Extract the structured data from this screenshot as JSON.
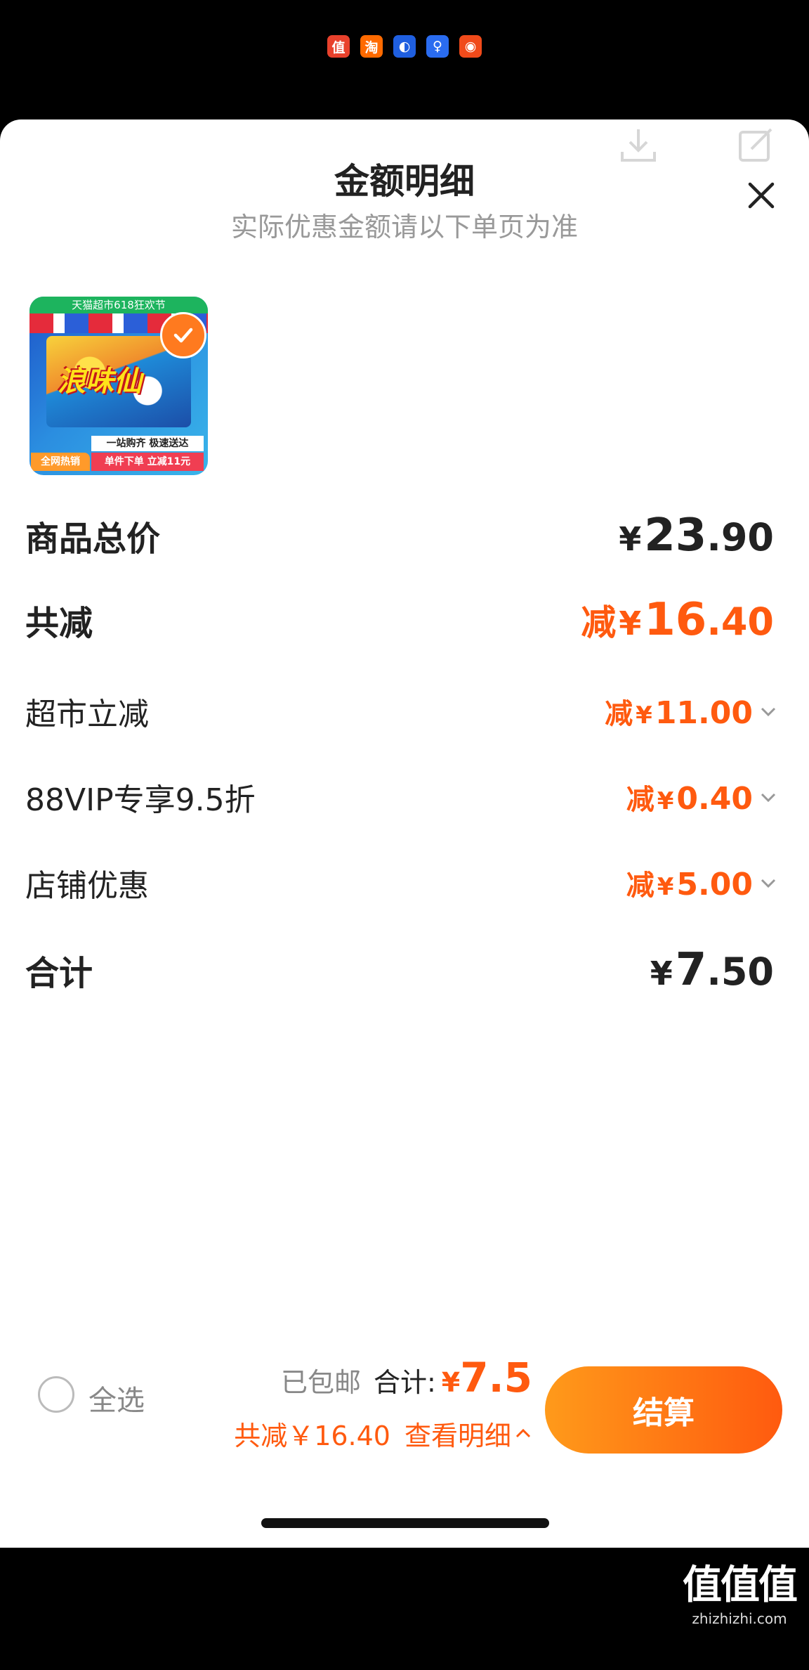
{
  "status_bar": {
    "app_icons": [
      {
        "name": "smzdm-app-icon",
        "glyph": "值",
        "color": "#e8412c"
      },
      {
        "name": "taobao-app-icon",
        "glyph": "淘",
        "color": "#ff6a00"
      },
      {
        "name": "blue-app-icon",
        "glyph": "◐",
        "color": "#1f5fe0"
      },
      {
        "name": "bulb-app-icon",
        "glyph": "♀",
        "color": "#2a6cf0"
      },
      {
        "name": "red-app-icon",
        "glyph": "◉",
        "color": "#f04a1a"
      }
    ]
  },
  "sheet": {
    "title": "金额明细",
    "subtitle": "实际优惠金额请以下单页为准"
  },
  "product": {
    "top_strip": "天猫超市618狂欢节",
    "brand": "浪味仙",
    "banner1": "一站购齐 极速送达",
    "banner2": "单件下单 立减11元",
    "hot_tag": "全网热销"
  },
  "rows": [
    {
      "label": "商品总价",
      "prefix": "",
      "yen": "¥",
      "int": "23",
      "dec": ".90"
    },
    {
      "label": "共减",
      "prefix": "减",
      "yen": "¥",
      "int": "16",
      "dec": ".40"
    },
    {
      "label": "超市立减",
      "prefix": "减",
      "yen": "¥",
      "int": "11",
      "dec": ".00"
    },
    {
      "label": "88VIP专享9.5折",
      "prefix": "减",
      "yen": "¥",
      "int": "0",
      "dec": ".40"
    },
    {
      "label": "店铺优惠",
      "prefix": "减",
      "yen": "¥",
      "int": "5",
      "dec": ".00"
    },
    {
      "label": "合计",
      "prefix": "",
      "yen": "¥",
      "int": "7",
      "dec": ".50"
    }
  ],
  "bottom_bar": {
    "select_all": "全选",
    "shipping": "已包邮",
    "total_label": "合计:",
    "total_yen": "¥",
    "total_value": "7.5",
    "saved": "共减￥16.40",
    "detail_link": "查看明细",
    "checkout": "结算"
  },
  "watermark": {
    "glyphs": "值值值",
    "domain": "zhizhizhi.com"
  },
  "colors": {
    "accent": "#ff5a0f",
    "button_start": "#ff9a1a",
    "text": "#222222",
    "muted": "#999999"
  }
}
